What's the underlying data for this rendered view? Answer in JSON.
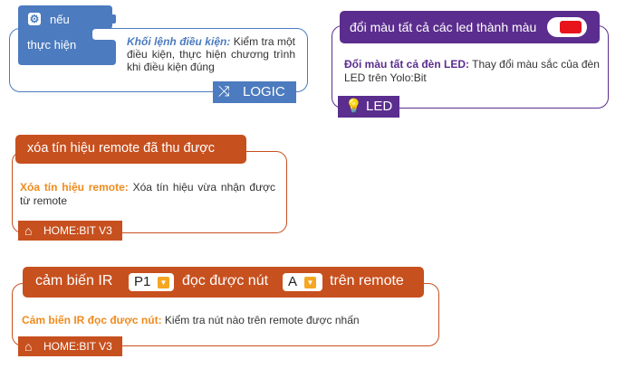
{
  "logic_card": {
    "block_if": "nếu",
    "block_do": "thực hiện",
    "desc_title": "Khối lệnh điều kiện:",
    "desc_text": " Kiểm tra một điều kiện, thực hiện chương trình khi điều kiện đúng",
    "tag_icon": "shuffle-icon",
    "tag_label": "LOGIC",
    "color": "#4c7bbf"
  },
  "led_card": {
    "block_text": "đổi màu tất cả các led thành màu",
    "swatch_color": "#e8141c",
    "desc_title": "Đổi màu tất cả đèn LED:",
    "desc_text": " Thay đổi màu sắc của đèn LED trên Yolo:Bit",
    "tag_icon": "lightbulb-icon",
    "tag_label": "LED",
    "color": "#5b2d8e"
  },
  "clear_card": {
    "block_text": "xóa tín hiệu remote đã thu được",
    "desc_title": "Xóa tín hiệu remote:",
    "desc_text": " Xóa tín hiệu vừa nhận được từ remote",
    "tag_icon": "home-icon",
    "tag_label": "HOME:BIT V3",
    "color": "#c7501f"
  },
  "ir_card": {
    "text_1": "cảm biến IR",
    "port_value": "P1",
    "text_2": "đọc được nút",
    "button_value": "A",
    "text_3": "trên remote",
    "desc_title": "Cảm biến IR đọc được nút:",
    "desc_text": " Kiểm tra nút nào trên remote được nhấn",
    "tag_icon": "home-icon",
    "tag_label": "HOME:BIT V3",
    "color": "#c7501f"
  }
}
